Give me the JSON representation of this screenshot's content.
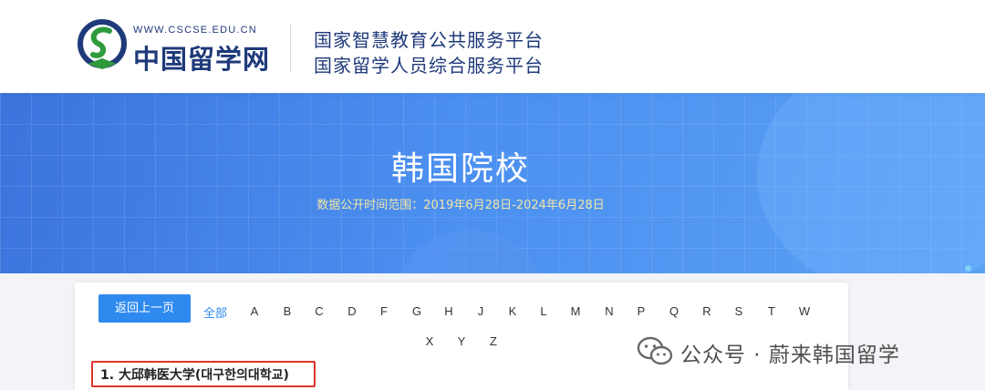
{
  "header": {
    "site_url": "WWW.CSCSE.EDU.CN",
    "site_name": "中国留学网",
    "tagline_1": "国家智慧教育公共服务平台",
    "tagline_2": "国家留学人员综合服务平台",
    "logo_icon": "cscse-logo-icon"
  },
  "banner": {
    "title": "韩国院校",
    "subtitle": "数据公开时间范围：2019年6月28日-2024年6月28日"
  },
  "filter": {
    "back_label": "返回上一页",
    "all_label": "全部",
    "letters_row1": [
      "A",
      "B",
      "C",
      "D",
      "F",
      "G",
      "H",
      "J",
      "K",
      "L",
      "M",
      "N",
      "P",
      "Q",
      "R",
      "S",
      "T",
      "W"
    ],
    "letters_row2": [
      "X",
      "Y",
      "Z"
    ]
  },
  "school_list": [
    {
      "index": "1.",
      "name": "大邱韩医大学(대구한의대학교)"
    }
  ],
  "watermark": {
    "text": "公众号 · 蔚来韩国留学",
    "icon": "wechat-icon"
  },
  "colors": {
    "brand_blue": "#1f3a7a",
    "accent": "#2f8af0",
    "highlight": "#e0342a"
  }
}
